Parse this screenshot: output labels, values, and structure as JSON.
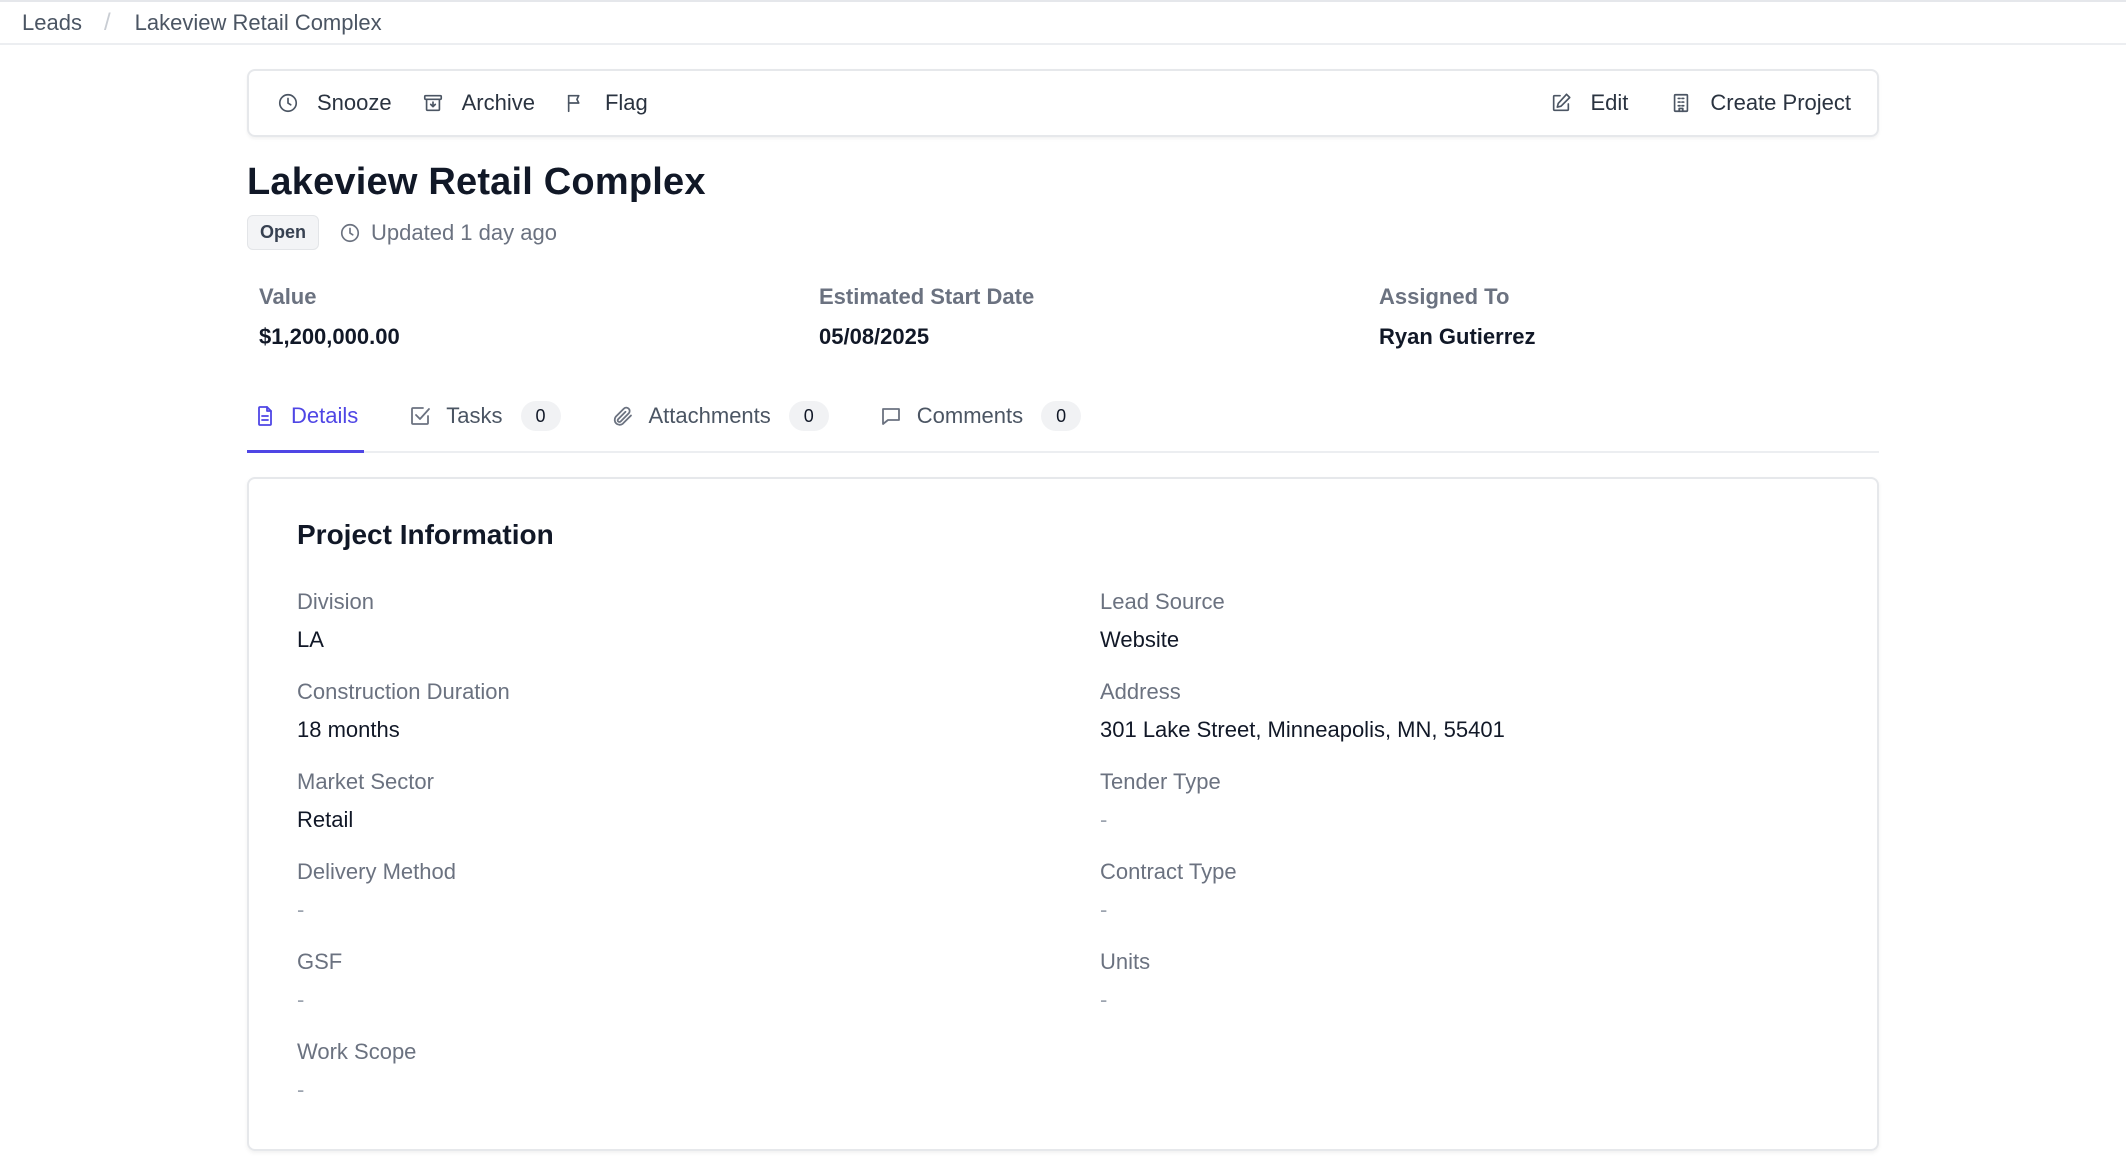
{
  "breadcrumb": {
    "parent": "Leads",
    "separator": "/",
    "current": "Lakeview Retail Complex"
  },
  "toolbar": {
    "snooze_label": "Snooze",
    "archive_label": "Archive",
    "flag_label": "Flag",
    "edit_label": "Edit",
    "create_project_label": "Create Project"
  },
  "lead": {
    "title": "Lakeview Retail Complex",
    "status": "Open",
    "updated": "Updated 1 day ago"
  },
  "summary": {
    "value_label": "Value",
    "value": "$1,200,000.00",
    "start_label": "Estimated Start Date",
    "start": "05/08/2025",
    "assigned_label": "Assigned To",
    "assigned": "Ryan Gutierrez"
  },
  "tabs": [
    {
      "label": "Details",
      "count": null,
      "active": true
    },
    {
      "label": "Tasks",
      "count": "0"
    },
    {
      "label": "Attachments",
      "count": "0"
    },
    {
      "label": "Comments",
      "count": "0"
    }
  ],
  "project_info": {
    "title": "Project Information",
    "division": {
      "label": "Division",
      "value": "LA"
    },
    "lead_source": {
      "label": "Lead Source",
      "value": "Website"
    },
    "construction_duration": {
      "label": "Construction Duration",
      "value": "18 months"
    },
    "address": {
      "label": "Address",
      "value": "301 Lake Street, Minneapolis, MN, 55401"
    },
    "market_sector": {
      "label": "Market Sector",
      "value": "Retail"
    },
    "tender_type": {
      "label": "Tender Type",
      "value": "-"
    },
    "delivery_method": {
      "label": "Delivery Method",
      "value": "-"
    },
    "contract_type": {
      "label": "Contract Type",
      "value": "-"
    },
    "gsf": {
      "label": "GSF",
      "value": "-"
    },
    "units": {
      "label": "Units",
      "value": "-"
    },
    "work_scope": {
      "label": "Work Scope",
      "value": "-"
    }
  },
  "colors": {
    "accent": "#4f46e5",
    "text_primary": "#111827",
    "text_muted": "#6b7280",
    "border": "#e6e8eb"
  }
}
